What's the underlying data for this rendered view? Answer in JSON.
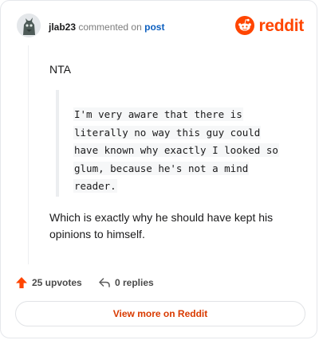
{
  "header": {
    "username": "jlab23",
    "action_text": "commented on",
    "post_link": "post"
  },
  "brand": {
    "wordmark": "reddit",
    "color": "#ff4500",
    "icon": "reddit-snoo-icon"
  },
  "comment": {
    "first_line": "NTA",
    "quote_lines": [
      "I'm very aware that there is",
      "literally no way this guy could",
      "have known why exactly I looked so",
      "glum, because he's not a mind",
      "reader."
    ],
    "second_paragraph": "Which is exactly why he should have kept his opinions to himself."
  },
  "footer": {
    "upvotes_label": "25 upvotes",
    "replies_label": "0 replies",
    "view_more_label": "View more on Reddit",
    "upvote_icon": "upvote-arrow-icon",
    "reply_icon": "reply-icon",
    "accent_color": "#d93a00"
  }
}
